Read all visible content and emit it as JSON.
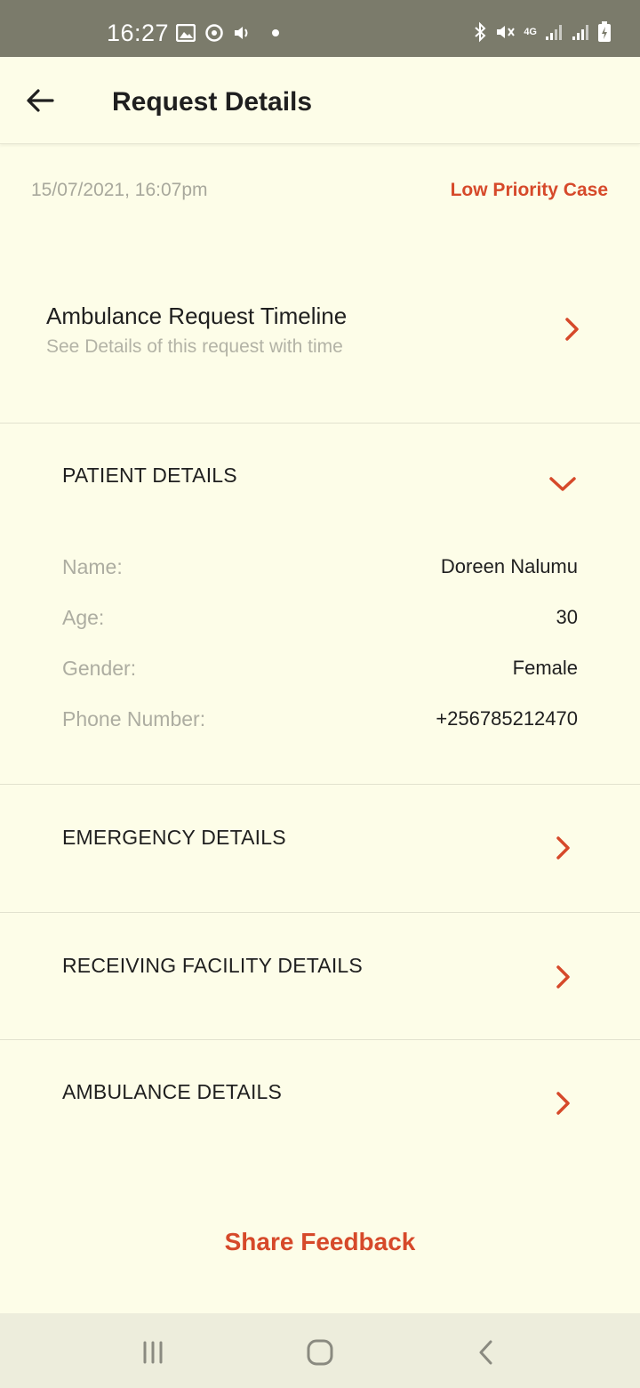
{
  "status_bar": {
    "time": "16:27",
    "left_icons": [
      "image-icon",
      "sync-icon",
      "volume-icon",
      "dot-icon"
    ],
    "network_label": "4G",
    "right_icons": [
      "bluetooth-icon",
      "mute-icon",
      "signal-icon",
      "signal-icon",
      "battery-charging-icon"
    ]
  },
  "header": {
    "back_icon": "arrow-left-icon",
    "title": "Request Details"
  },
  "meta": {
    "date": "15/07/2021, 16:07pm",
    "priority": "Low Priority Case"
  },
  "timeline": {
    "title": "Ambulance Request Timeline",
    "subtitle": "See Details of this request with time"
  },
  "patient": {
    "heading": "PATIENT DETAILS",
    "fields": [
      {
        "label": "Name:",
        "value": "Doreen Nalumu"
      },
      {
        "label": "Age:",
        "value": "30"
      },
      {
        "label": "Gender:",
        "value": "Female"
      },
      {
        "label": "Phone Number:",
        "value": "+256785212470"
      }
    ]
  },
  "sections": [
    {
      "heading": "EMERGENCY DETAILS"
    },
    {
      "heading": "RECEIVING FACILITY DETAILS"
    },
    {
      "heading": "AMBULANCE DETAILS"
    }
  ],
  "feedback_label": "Share Feedback",
  "colors": {
    "accent": "#d6492a",
    "background": "#fdfde8",
    "status_bar": "#7b7b6b",
    "muted_text": "#adada1"
  },
  "nav_bar": {
    "icons": [
      "recent-apps-icon",
      "home-icon",
      "back-nav-icon"
    ]
  }
}
